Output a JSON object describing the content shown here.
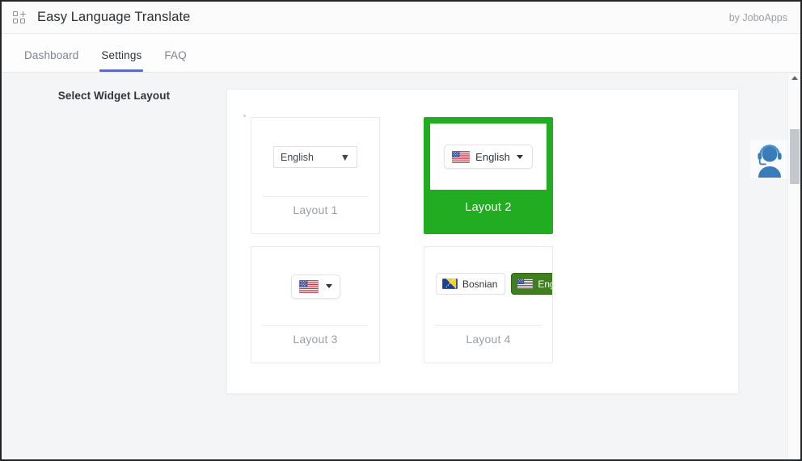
{
  "header": {
    "logo_icon": "widget-grid-plus-icon",
    "title": "Easy Language Translate",
    "credit": "by JoboApps"
  },
  "tabs": [
    {
      "label": "Dashboard",
      "active": false
    },
    {
      "label": "Settings",
      "active": true
    },
    {
      "label": "FAQ",
      "active": false
    }
  ],
  "sidebar": {
    "section_label": "Select Widget Layout"
  },
  "layouts": [
    {
      "caption": "Layout 1",
      "selected": false,
      "preview_kind": "plain-select",
      "language": "English",
      "caret_icon": "chevron-down-icon"
    },
    {
      "caption": "Layout 2",
      "selected": true,
      "preview_kind": "flag-text-pill",
      "language": "English",
      "flag_icon": "us-flag-icon",
      "caret_icon": "chevron-down-icon"
    },
    {
      "caption": "Layout 3",
      "selected": false,
      "preview_kind": "flag-only-pill",
      "language": "",
      "flag_icon": "us-flag-icon",
      "caret_icon": "chevron-down-icon"
    },
    {
      "caption": "Layout 4",
      "selected": false,
      "preview_kind": "two-flag-buttons",
      "buttons": [
        {
          "label": "Bosnian",
          "flag_icon": "bosnia-flag-icon",
          "active": false
        },
        {
          "label": "Engl",
          "flag_icon": "us-flag-icon",
          "active": true
        }
      ]
    }
  ],
  "support": {
    "icon": "support-agent-headset-icon"
  },
  "scrollbar": {
    "up_arrow_icon": "scroll-up-arrow-icon"
  },
  "colors": {
    "selected_green": "#22ac22",
    "tab_underline": "#5c6bc0",
    "page_background": "#f4f5f7",
    "panel_background": "#ffffff",
    "support_blue": "#3a7bba"
  }
}
